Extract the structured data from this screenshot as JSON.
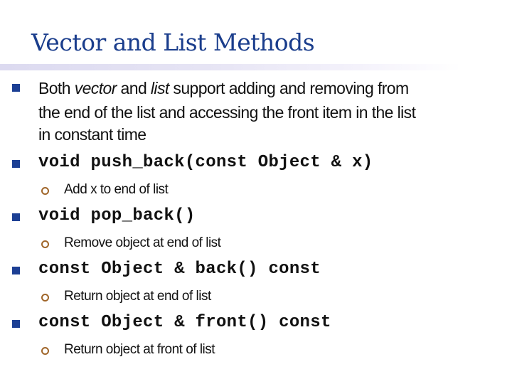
{
  "slide": {
    "title": "Vector and List Methods",
    "colors": {
      "title": "#1a3d8c",
      "primary_bullet": "#1c3f94",
      "secondary_bullet": "#a0662a",
      "text": "#111111"
    },
    "bullets": [
      {
        "type": "text",
        "lines": [
          {
            "segments": [
              {
                "text": "Both ",
                "italic": false
              },
              {
                "text": "vector",
                "italic": true
              },
              {
                "text": " and ",
                "italic": false
              },
              {
                "text": "list",
                "italic": true
              },
              {
                "text": " support adding and removing from",
                "italic": false
              }
            ]
          },
          {
            "text": "the end of the list and accessing the front item in the list"
          },
          {
            "text": "in constant time"
          }
        ]
      },
      {
        "type": "code",
        "text": "void push_back(const Object & x)",
        "sub": [
          "Add x to end of list"
        ]
      },
      {
        "type": "code",
        "text": "void pop_back()",
        "sub": [
          "Remove object at end of list"
        ]
      },
      {
        "type": "code",
        "text": "const Object & back() const",
        "sub": [
          "Return object at end of list"
        ]
      },
      {
        "type": "code",
        "text": "const Object & front() const",
        "sub": [
          "Return object at front of list"
        ]
      }
    ]
  }
}
